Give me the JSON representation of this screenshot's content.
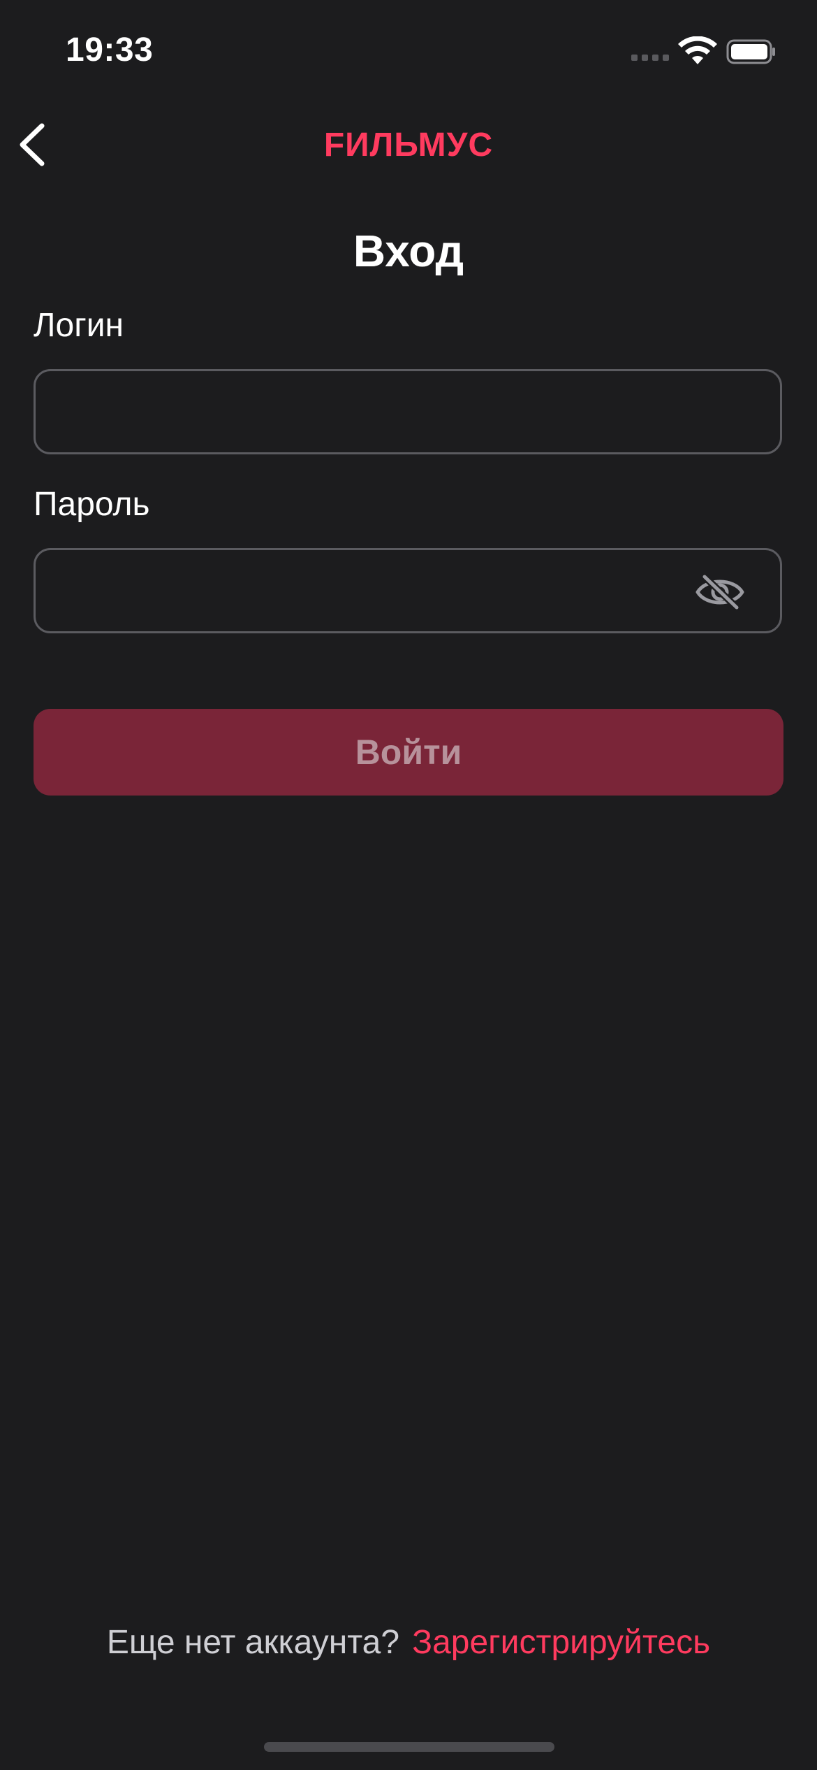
{
  "status_bar": {
    "time": "19:33"
  },
  "nav": {
    "title": "FИЛЬМУС",
    "back_icon": "chevron-left-icon"
  },
  "page": {
    "title": "Вход"
  },
  "form": {
    "login_label": "Логин",
    "login_value": "",
    "password_label": "Пароль",
    "password_value": "",
    "password_toggle_icon": "eye-slash-icon",
    "submit_label": "Войти"
  },
  "footer": {
    "prompt": "Еще нет аккаунта?",
    "register_link": "Зарегистрируйтесь"
  },
  "colors": {
    "background": "#1c1c1e",
    "accent": "#ff3b5f",
    "button_disabled": "#7a2538"
  }
}
